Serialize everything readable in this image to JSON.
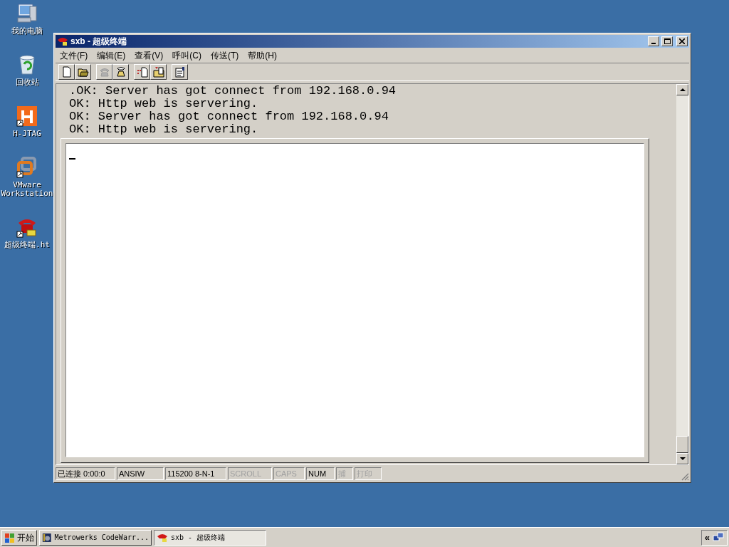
{
  "desktop_icons": [
    {
      "label": "我的电脑",
      "kind": "computer"
    },
    {
      "label": "回收站",
      "kind": "recycle"
    },
    {
      "label": "H-JTAG",
      "kind": "hjtag"
    },
    {
      "label": "VMware Workstation",
      "kind": "vmware"
    },
    {
      "label": "超级终端.ht",
      "kind": "phone"
    }
  ],
  "window": {
    "title": "sxb - 超级终端",
    "menu": [
      "文件(F)",
      "编辑(E)",
      "查看(V)",
      "呼叫(C)",
      "传送(T)",
      "帮助(H)"
    ],
    "toolbar": [
      {
        "kind": "new",
        "disabled": false
      },
      {
        "kind": "open",
        "disabled": false
      },
      {
        "kind": "sep"
      },
      {
        "kind": "call",
        "disabled": true
      },
      {
        "kind": "hangup",
        "disabled": false
      },
      {
        "kind": "sep"
      },
      {
        "kind": "send",
        "disabled": false
      },
      {
        "kind": "receive",
        "disabled": false
      },
      {
        "kind": "sep"
      },
      {
        "kind": "properties",
        "disabled": false
      }
    ],
    "terminal_lines": [
      ".OK: Server has got connect from 192.168.0.94",
      "OK: Http web is servering.",
      "OK: Server has got connect from 192.168.0.94",
      "OK: Http web is servering."
    ],
    "status_bar": [
      {
        "text": "已连接 0:00:0",
        "disabled": false
      },
      {
        "text": "ANSIW",
        "disabled": false
      },
      {
        "text": "115200 8-N-1",
        "disabled": false
      },
      {
        "text": "SCROLL",
        "disabled": true
      },
      {
        "text": "CAPS",
        "disabled": true
      },
      {
        "text": "NUM",
        "disabled": false
      },
      {
        "text": "捕",
        "disabled": true
      },
      {
        "text": "打印",
        "disabled": true
      }
    ]
  },
  "taskbar": {
    "start": "开始",
    "tasks": [
      {
        "label": "Metrowerks CodeWarr...",
        "kind": "codewarrior",
        "selected": false
      },
      {
        "label": "sxb - 超级终端",
        "kind": "phone",
        "selected": true
      }
    ],
    "tray_toggle": "«"
  }
}
